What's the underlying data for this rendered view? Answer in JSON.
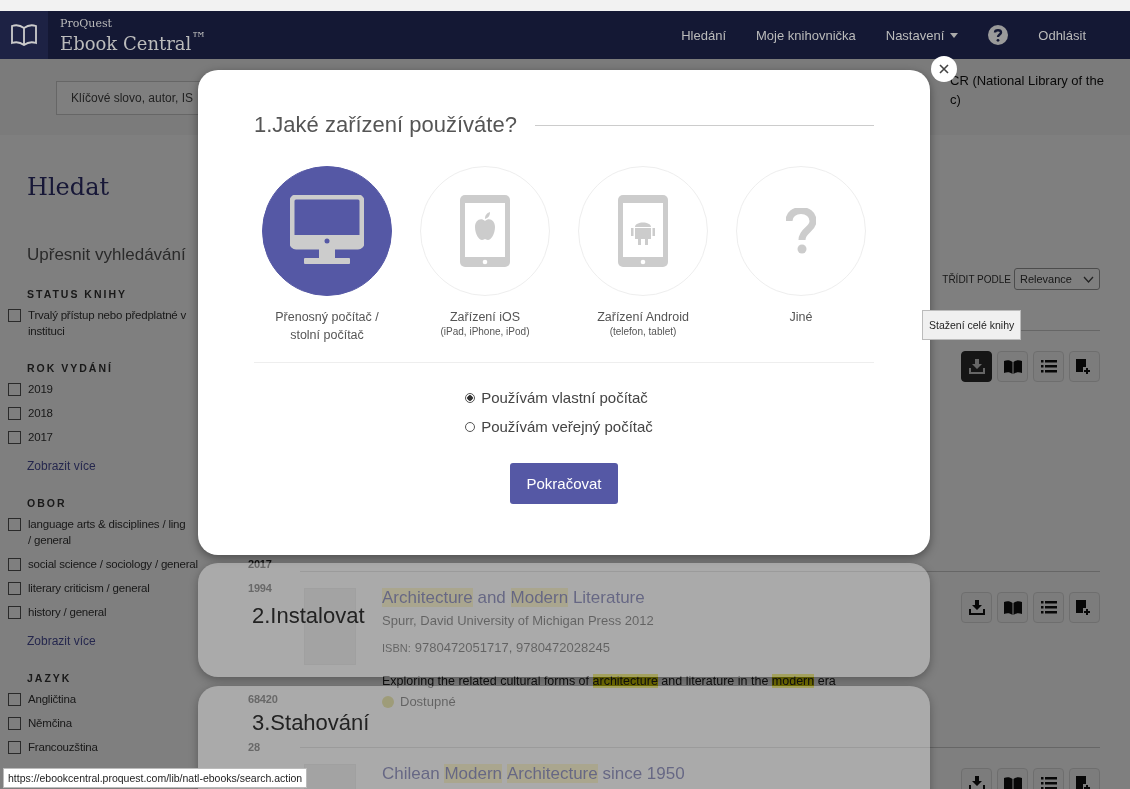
{
  "nav": {
    "brand_top": "ProQuest",
    "brand": "Ebook Central$^{™}$",
    "links": [
      {
        "kind": "link",
        "label": "Hledání"
      },
      {
        "kind": "link",
        "label": "Moje knihovnička"
      },
      {
        "kind": "dropdown",
        "label": "Nastavení"
      },
      {
        "kind": "help"
      },
      {
        "kind": "link",
        "label": "Odhlásit"
      }
    ]
  },
  "search": {
    "placeholder": "Klíčové slovo, autor, IS"
  },
  "institution": [
    "CR (National Library of the",
    "c)"
  ],
  "sidebar": {
    "title": "Hledat",
    "subtitle": "Upřesnit vyhledávání",
    "groups": [
      {
        "title": "STATUS KNIHY",
        "items": [
          {
            "lines": [
              "Trvalý přístup nebo předplatné v",
              "instituci"
            ],
            "checked": false
          }
        ]
      },
      {
        "title": "ROK VYDÁNÍ",
        "items": [
          {
            "lines": [
              "2019"
            ],
            "checked": false
          },
          {
            "lines": [
              "2018"
            ],
            "checked": false
          },
          {
            "lines": [
              "2017"
            ],
            "checked": false
          }
        ],
        "more": "Zobrazit více"
      },
      {
        "title": "OBOR",
        "items": [
          {
            "lines": [
              "language arts & disciplines / ling",
              "/ general"
            ],
            "checked": false
          },
          {
            "lines": [
              "social science / sociology / general"
            ],
            "count": "2017",
            "checked": false
          },
          {
            "lines": [
              "literary criticism / general"
            ],
            "count": "1994",
            "checked": false
          },
          {
            "lines": [
              "history / general"
            ],
            "checked": false
          }
        ],
        "more": "Zobrazit více"
      },
      {
        "title": "JAZYK",
        "items": [
          {
            "lines": [
              "Angličtina"
            ],
            "count": "68420",
            "checked": false
          },
          {
            "lines": [
              "Němčina"
            ],
            "checked": false
          },
          {
            "lines": [
              "Francouzština"
            ],
            "count": "28",
            "checked": false
          }
        ]
      }
    ]
  },
  "sort": {
    "label": "TŘÍDIT PODLE",
    "value": "Relevance"
  },
  "tooltip": "Stažení celé knihy",
  "results": [
    {
      "actions": [
        {
          "kind": "download",
          "active": true
        },
        {
          "kind": "read",
          "active": false
        },
        {
          "kind": "toc",
          "active": false
        },
        {
          "kind": "add",
          "active": false
        }
      ]
    },
    {
      "title": [
        {
          "text": "Architecture",
          "highlight": true
        },
        {
          "text": " and ",
          "highlight": false
        },
        {
          "text": "Modern",
          "highlight": true
        },
        {
          "text": " Literature",
          "highlight": false
        }
      ],
      "meta": "Spurr, David  University of Michigan Press  2012",
      "isbn_label": "ISBN:",
      "isbn": "9780472051717, 9780472028245",
      "description": [
        {
          "text": "Exploring the related cultural forms of ",
          "highlight": false
        },
        {
          "text": "architecture",
          "highlight": true
        },
        {
          "text": " and literature in the ",
          "highlight": false
        },
        {
          "text": "modern",
          "highlight": true
        },
        {
          "text": " era",
          "highlight": false
        }
      ],
      "availability": "Dostupné",
      "actions": [
        {
          "kind": "download",
          "active": false
        },
        {
          "kind": "read",
          "active": false
        },
        {
          "kind": "toc",
          "active": false
        },
        {
          "kind": "add",
          "active": false
        }
      ]
    },
    {
      "title": [
        {
          "text": "Chilean ",
          "highlight": false
        },
        {
          "text": "Modern",
          "highlight": true
        },
        {
          "text": "Architecture",
          "highlight": true
        },
        {
          "text": " since 1950",
          "highlight": false
        }
      ],
      "actions": [
        {
          "kind": "download",
          "active": false
        },
        {
          "kind": "read",
          "active": false
        },
        {
          "kind": "toc",
          "active": false
        },
        {
          "kind": "add",
          "active": false
        }
      ]
    }
  ],
  "modal": {
    "title": "1.Jaké zařízení používáte?",
    "devices": [
      {
        "kind": "desktop",
        "label": "Přenosný počítač /",
        "label2": "stolní počítač",
        "selected": true
      },
      {
        "kind": "ios",
        "label": "Zařízení iOS",
        "sublabel": "(iPad, iPhone, iPod)",
        "selected": false
      },
      {
        "kind": "android",
        "label": "Zařízení Android",
        "sublabel": "(telefon, tablet)",
        "selected": false
      },
      {
        "kind": "other",
        "label": "Jiné",
        "selected": false
      }
    ],
    "options": [
      {
        "label": "Používám vlastní počítač",
        "selected": true
      },
      {
        "label": "Používám veřejný počítač",
        "selected": false
      }
    ],
    "button": "Pokračovat"
  },
  "steps": [
    {
      "title": "2.Instalovat"
    },
    {
      "title": "3.Stahování"
    }
  ],
  "status_url": "https://ebookcentral.proquest.com/lib/natl-ebooks/search.action"
}
